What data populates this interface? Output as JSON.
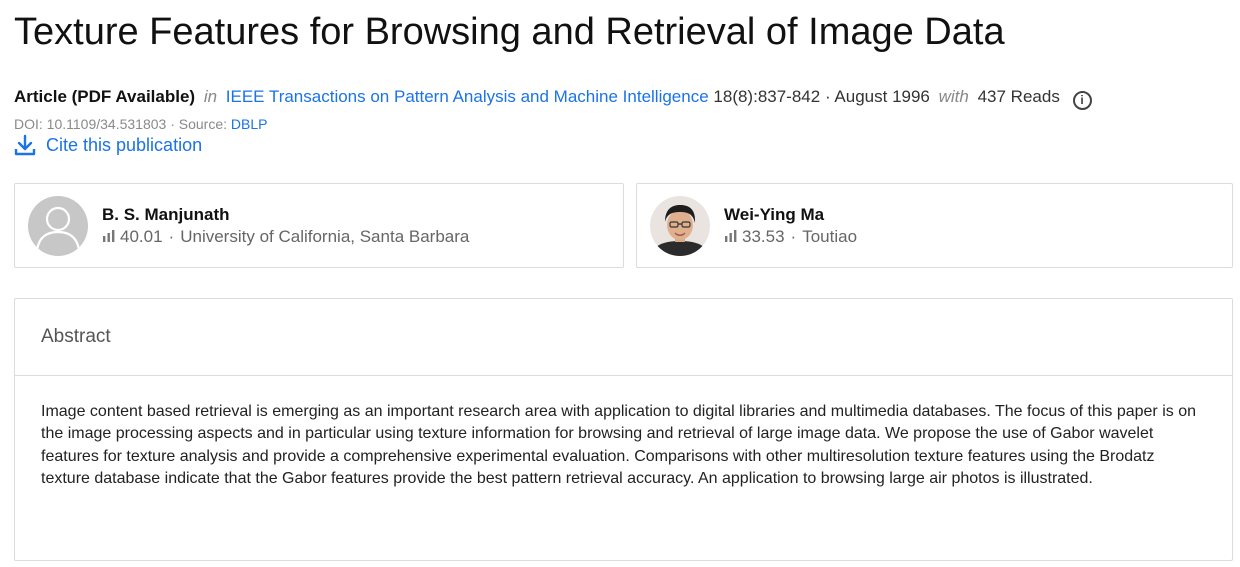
{
  "title": "Texture Features for Browsing and Retrieval of Image Data",
  "meta": {
    "type_label": "Article (PDF Available)",
    "in_label": "in",
    "journal": "IEEE Transactions on Pattern Analysis and Machine Intelligence",
    "volume": "18(8):837-842",
    "separator": "·",
    "date": "August 1996",
    "with_label": "with",
    "reads": "437 Reads",
    "info_icon": "info-icon"
  },
  "doi": {
    "text": "DOI: 10.1109/34.531803",
    "source_label": "Source:",
    "source_link": "DBLP"
  },
  "cite": {
    "label": "Cite this publication",
    "icon": "download-icon"
  },
  "authors": [
    {
      "name": "B. S. Manjunath",
      "score": "40.01",
      "affiliation": "University of California, Santa Barbara",
      "avatar": "default-avatar"
    },
    {
      "name": "Wei-Ying Ma",
      "score": "33.53",
      "affiliation": "Toutiao",
      "avatar": "photo-avatar"
    }
  ],
  "abstract": {
    "heading": "Abstract",
    "text": "Image content based retrieval is emerging as an important research area with application to digital libraries and multimedia databases. The focus of this paper is on the image processing aspects and in particular using texture information for browsing and retrieval of large image data. We propose the use of Gabor wavelet features for texture analysis and provide a comprehensive experimental evaluation. Comparisons with other multiresolution texture features using the Brodatz texture database indicate that the Gabor features provide the best pattern retrieval accuracy. An application to browsing large air photos is illustrated."
  },
  "colors": {
    "link": "#1a73e8",
    "border": "#dcdcdc",
    "muted": "#8a8a8a"
  }
}
